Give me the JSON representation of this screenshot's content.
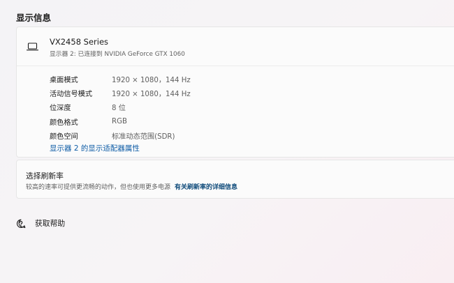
{
  "section_title": "显示信息",
  "display": {
    "name": "VX2458 Series",
    "subtitle": "显示器 2: 已连接到 NVIDIA GeForce GTX 1060",
    "properties": [
      {
        "label": "桌面模式",
        "value": "1920 × 1080，144 Hz"
      },
      {
        "label": "活动信号模式",
        "value": "1920 × 1080，144 Hz"
      },
      {
        "label": "位深度",
        "value": "8 位"
      },
      {
        "label": "颜色格式",
        "value": "RGB"
      },
      {
        "label": "颜色空间",
        "value": "标准动态范围(SDR)"
      }
    ],
    "adapter_link": "显示器 2 的显示适配器属性"
  },
  "refresh_rate": {
    "title": "选择刷新率",
    "description": "较高的速率可提供更流畅的动作，但也使用更多电源",
    "link": "有关刷新率的详细信息"
  },
  "help": {
    "label": "获取帮助",
    "icon": "help-icon"
  }
}
